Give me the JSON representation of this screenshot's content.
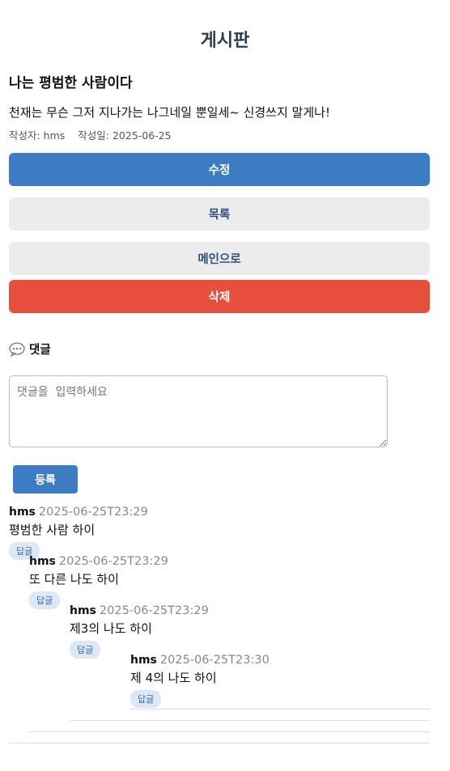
{
  "page": {
    "title": "게시판"
  },
  "post": {
    "title": "나는 평범한 사람이다",
    "content": "천재는 무슨 그저 지나가는 나그네일 뿐일세~ 신경쓰지 말게나!",
    "author_label": "작성자: hms",
    "date_label": "작성일: 2025-06-25"
  },
  "buttons": {
    "edit": "수정",
    "list": "목록",
    "main": "메인으로",
    "delete": "삭제"
  },
  "comments_section": {
    "header": "댓글",
    "icon": "speech-bubble-icon",
    "input_placeholder": "댓글을  입력하세요",
    "submit": "등록"
  },
  "comments": [
    {
      "author": "hms",
      "date": "2025-06-25T23:29",
      "text": "평범한 사람 하이",
      "reply_label": "답글",
      "depth": 0
    },
    {
      "author": "hms",
      "date": "2025-06-25T23:29",
      "text": "또 다른 나도 하이",
      "reply_label": "답글",
      "depth": 1
    },
    {
      "author": "hms",
      "date": "2025-06-25T23:29",
      "text": "제3의 나도 하이",
      "reply_label": "답글",
      "depth": 2
    },
    {
      "author": "hms",
      "date": "2025-06-25T23:30",
      "text": "제 4의 나도 하이",
      "reply_label": "답글",
      "depth": 3
    }
  ],
  "colors": {
    "primary": "#3d7bc4",
    "danger": "#e84e3c",
    "secondary_bg": "#ececec",
    "title": "#2c3e50"
  }
}
